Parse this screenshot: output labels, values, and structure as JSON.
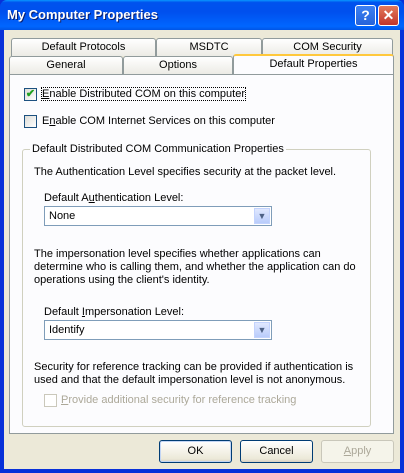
{
  "window": {
    "title": "My Computer Properties",
    "help_glyph": "?",
    "close_glyph": "✕"
  },
  "tabs": {
    "row1": [
      "Default Protocols",
      "MSDTC",
      "COM Security"
    ],
    "row2": [
      "General",
      "Options",
      "Default Properties"
    ],
    "active": "Default Properties"
  },
  "options": {
    "enable_dcom": {
      "label_pre": "",
      "label_u": "E",
      "label_post": "nable Distributed COM on this computer",
      "checked": true
    },
    "enable_cis": {
      "label_pre": "E",
      "label_u": "n",
      "label_post": "able COM Internet Services on this computer",
      "checked": false
    }
  },
  "group": {
    "title": "Default Distributed COM Communication Properties",
    "auth_desc": "The Authentication Level specifies security at the packet level.",
    "auth_label_pre": "Default A",
    "auth_label_u": "u",
    "auth_label_post": "thentication Level:",
    "auth_value": "None",
    "imp_desc": "The impersonation level specifies whether applications can determine who is calling them, and whether the application can do operations using the client's identity.",
    "imp_label_pre": "Default ",
    "imp_label_u": "I",
    "imp_label_post": "mpersonation Level:",
    "imp_value": "Identify",
    "ref_desc": "Security for reference tracking can be provided if authentication is used and that the default impersonation level is not anonymous.",
    "ref_label_pre": "",
    "ref_label_u": "P",
    "ref_label_post": "rovide additional security for reference tracking",
    "ref_checked": false
  },
  "buttons": {
    "ok": "OK",
    "cancel": "Cancel",
    "apply_pre": "",
    "apply_u": "A",
    "apply_post": "pply"
  },
  "colors": {
    "titlebar": "#0053ee",
    "active_tab_accent": "#ffc83c",
    "dialog_bg": "#ece9d8"
  }
}
